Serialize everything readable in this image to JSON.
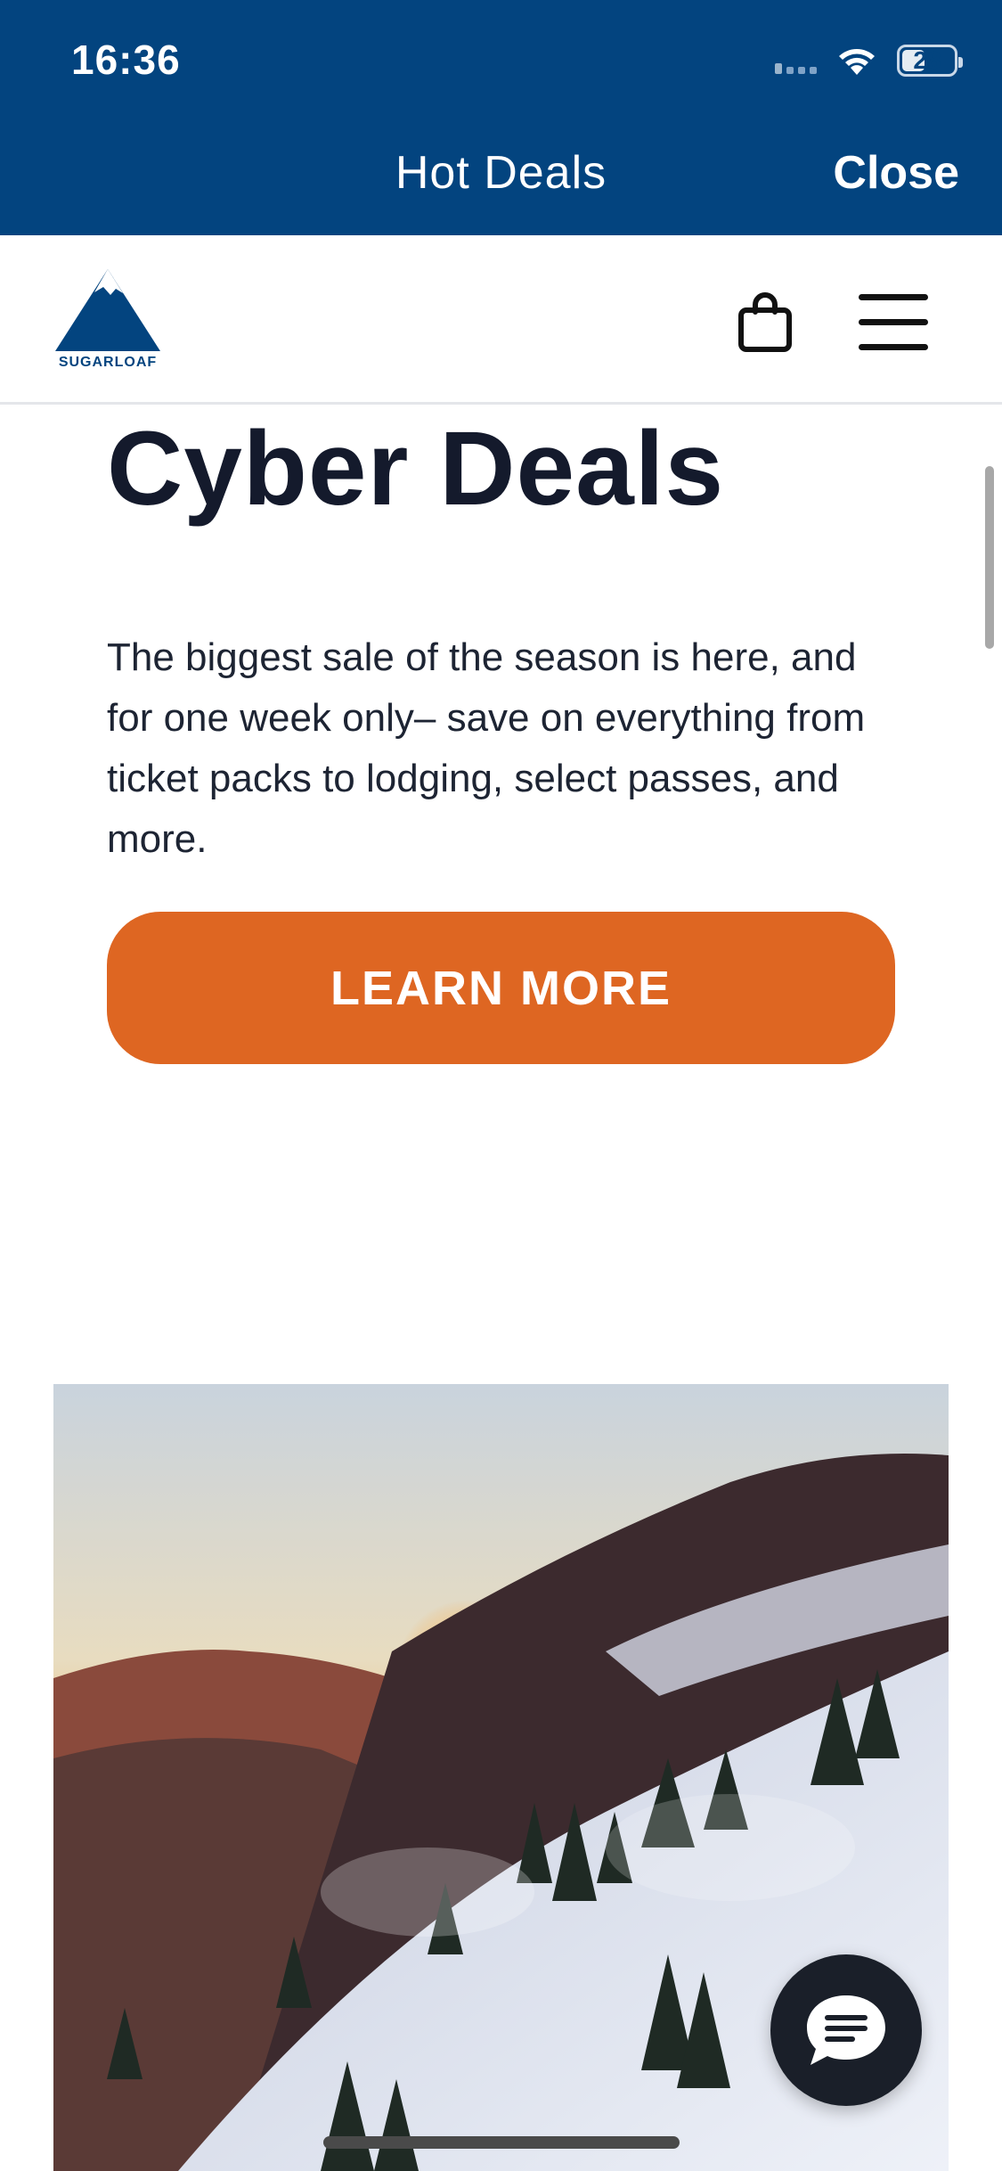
{
  "status_bar": {
    "time": "16:36",
    "battery": "28"
  },
  "modal": {
    "title": "Hot Deals",
    "close_label": "Close"
  },
  "site_header": {
    "logo_text": "SUGARLOAF"
  },
  "content": {
    "title": "Cyber Deals",
    "description": "The biggest sale of the season is here, and for one week only– save on everything from ticket packs to lodging, select passes, and more.",
    "cta_label": "LEARN MORE"
  },
  "colors": {
    "brand_blue": "#03447f",
    "cta_orange": "#de6622",
    "heading": "#141a2c",
    "chat_button": "#1a1f29"
  },
  "icons": [
    "wifi-icon",
    "signal-icon",
    "battery-icon",
    "mountain-logo-icon",
    "shopping-bag-icon",
    "hamburger-menu-icon",
    "chat-icon"
  ]
}
